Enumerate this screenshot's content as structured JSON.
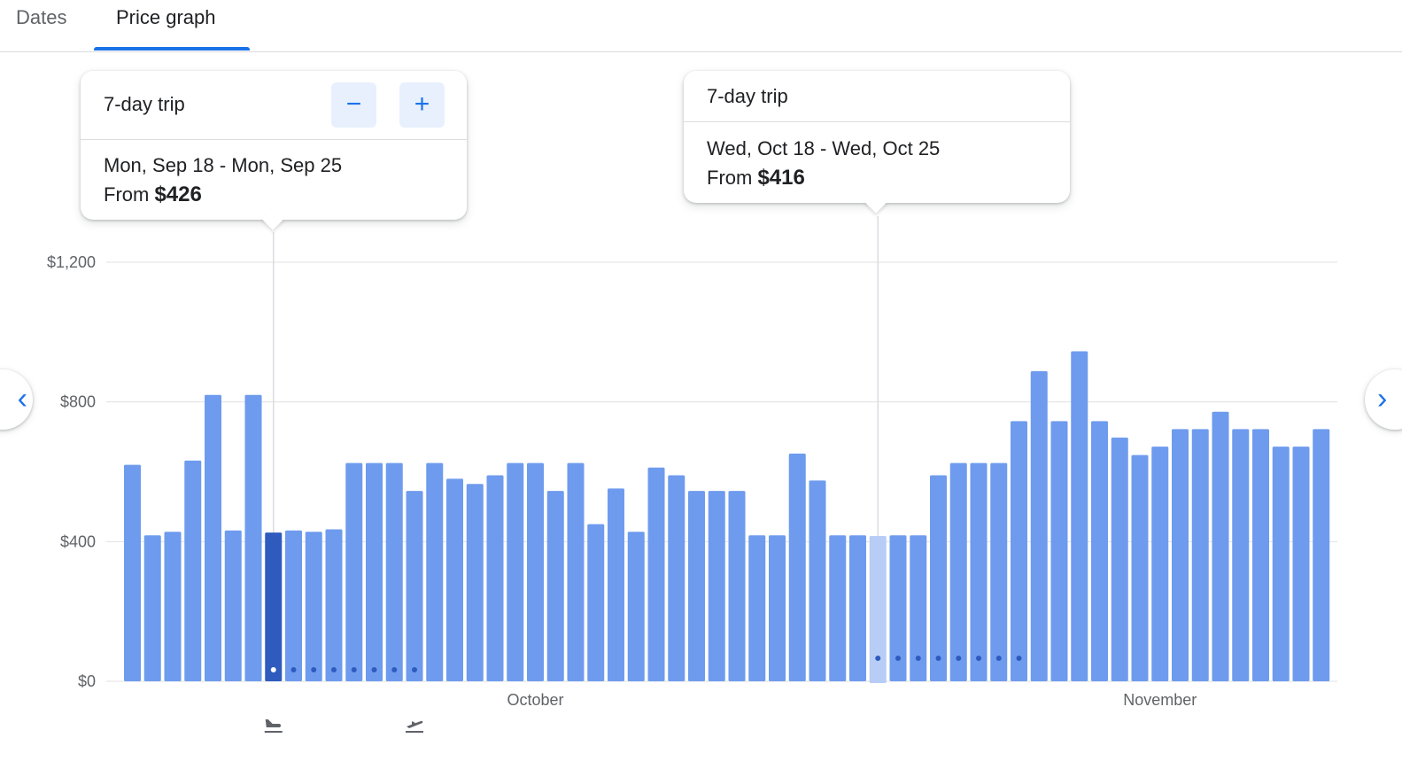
{
  "tabs": [
    {
      "label": "Dates",
      "active": false
    },
    {
      "label": "Price graph",
      "active": true
    }
  ],
  "tooltip_left": {
    "trip_label": "7-day trip",
    "decrease_label": "−",
    "increase_label": "+",
    "dates": "Mon, Sep 18 - Mon, Sep 25",
    "from_prefix": "From",
    "price": "$426"
  },
  "tooltip_right": {
    "trip_label": "7-day trip",
    "dates": "Wed, Oct 18 - Wed, Oct 25",
    "from_prefix": "From",
    "price": "$416"
  },
  "nav": {
    "prev_icon": "chevron-left-icon",
    "next_icon": "chevron-right-icon"
  },
  "colors": {
    "bar": "#6e9bee",
    "bar_selected": "#2f5bbe",
    "bar_hover": "#b7cdf6",
    "dot": "#2f5bbe",
    "grid": "#e0e0e0",
    "accent": "#1a73e8"
  },
  "chart_data": {
    "type": "bar",
    "ylim": [
      0,
      1200
    ],
    "yticks": [
      "$0",
      "$400",
      "$800",
      "$1,200"
    ],
    "ytick_values": [
      0,
      400,
      800,
      1200
    ],
    "month_labels": [
      "October",
      "November"
    ],
    "month_label_index": [
      20,
      51
    ],
    "values": [
      620,
      418,
      428,
      632,
      820,
      432,
      820,
      426,
      432,
      428,
      435,
      625,
      625,
      625,
      545,
      625,
      580,
      565,
      590,
      625,
      625,
      545,
      625,
      450,
      552,
      428,
      612,
      590,
      545,
      545,
      545,
      418,
      418,
      652,
      575,
      418,
      418,
      416,
      418,
      418,
      590,
      625,
      625,
      625,
      745,
      888,
      745,
      945,
      745,
      698,
      648,
      672,
      722,
      722,
      772,
      722,
      722,
      672,
      672,
      722
    ],
    "selected_index": 7,
    "hover_index": 37,
    "trip_dot_ranges": [
      [
        7,
        14
      ],
      [
        37,
        44
      ]
    ],
    "departure_icon": "airplane-takeoff-icon",
    "return_icon": "airplane-landing-icon"
  }
}
